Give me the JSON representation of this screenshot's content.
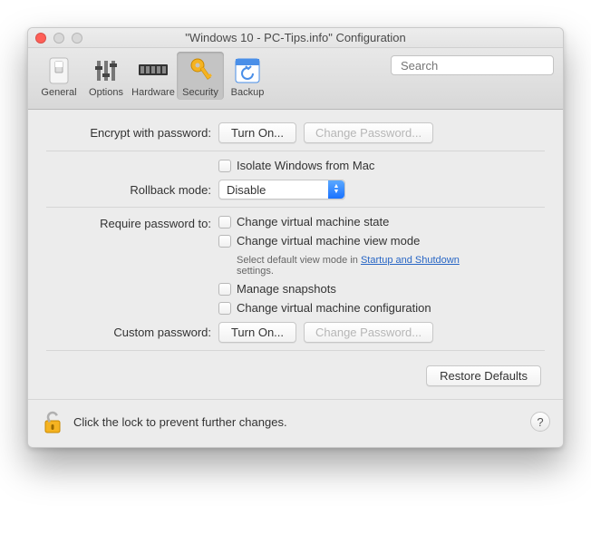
{
  "window": {
    "title": "\"Windows 10 - PC-Tips.info\" Configuration"
  },
  "toolbar": {
    "items": [
      {
        "label": "General"
      },
      {
        "label": "Options"
      },
      {
        "label": "Hardware"
      },
      {
        "label": "Security"
      },
      {
        "label": "Backup"
      }
    ]
  },
  "search": {
    "placeholder": "Search"
  },
  "encrypt": {
    "label": "Encrypt with password:",
    "turn_on": "Turn On...",
    "change": "Change Password..."
  },
  "isolate": {
    "label": "Isolate Windows from Mac"
  },
  "rollback": {
    "label": "Rollback mode:",
    "value": "Disable"
  },
  "require": {
    "label": "Require password to:",
    "opt1": "Change virtual machine state",
    "opt2": "Change virtual machine view mode",
    "help_pre": "Select default view mode in ",
    "help_link": "Startup and Shutdown",
    "help_post": " settings.",
    "opt3": "Manage snapshots",
    "opt4": "Change virtual machine configuration"
  },
  "custom": {
    "label": "Custom password:",
    "turn_on": "Turn On...",
    "change": "Change Password..."
  },
  "restore": {
    "label": "Restore Defaults"
  },
  "footer": {
    "text": "Click the lock to prevent further changes.",
    "help": "?"
  }
}
